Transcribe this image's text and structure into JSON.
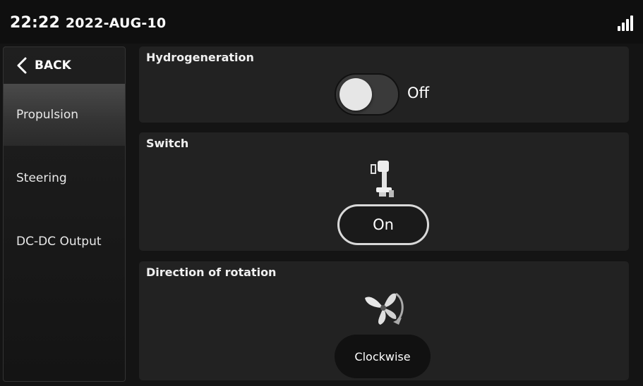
{
  "status": {
    "time": "22:22",
    "date": "2022-AUG-10",
    "signal_icon": "signal-bars-icon"
  },
  "sidebar": {
    "back_label": "BACK",
    "items": [
      {
        "label": "Propulsion",
        "active": true
      },
      {
        "label": "Steering",
        "active": false
      },
      {
        "label": "DC-DC Output",
        "active": false
      }
    ]
  },
  "panels": {
    "hydrogeneration": {
      "title": "Hydrogeneration",
      "state": "Off"
    },
    "switch": {
      "title": "Switch",
      "icon": "outboard-motor-icon",
      "button_label": "On"
    },
    "rotation": {
      "title": "Direction of rotation",
      "icon": "propeller-rotation-icon",
      "button_label": "Clockwise"
    }
  },
  "colors": {
    "background": "#141414",
    "panel": "#222222",
    "active_item": "#3a3a3a",
    "text": "#ffffff"
  }
}
